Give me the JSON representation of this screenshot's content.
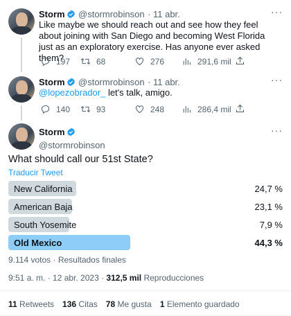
{
  "tweets": [
    {
      "name": "Storm",
      "handle": "@stormrobinson",
      "date": "· 11 abr.",
      "text": "Like maybe we should reach out and see how they feel about joining with San Diego and becoming West Florida just as an exploratory exercise. Has anyone ever asked them?",
      "replies": "197",
      "retweets": "68",
      "likes": "276",
      "views": "291,6 mil"
    },
    {
      "name": "Storm",
      "handle": "@stormrobinson",
      "date": "· 11 abr.",
      "mention": "@lopezobrador_",
      "text": " let's talk, amigo.",
      "replies": "140",
      "retweets": "93",
      "likes": "248",
      "views": "286,4 mil"
    }
  ],
  "main": {
    "name": "Storm",
    "handle": "@stormrobinson",
    "text": "What should call our 51st State?",
    "translate": "Traducir Tweet",
    "poll": {
      "options": [
        {
          "label": "New California",
          "pct": "24,7 %",
          "value": 24.7
        },
        {
          "label": "American Baja",
          "pct": "23,1 %",
          "value": 23.1
        },
        {
          "label": "South Yosemite",
          "pct": "7,9 %",
          "value": 7.9
        },
        {
          "label": "Old Mexico",
          "pct": "44,3 %",
          "value": 44.3,
          "winner": true
        }
      ],
      "summary": "9.114 votos · Resultados finales"
    },
    "timestamp": "9:51 a. m. · 12 abr. 2023 · ",
    "views_count": "312,5 mil",
    "views_label": " Reproducciones",
    "stats": {
      "retweets_count": "11",
      "retweets_label": " Retweets",
      "quotes_count": "136",
      "quotes_label": " Citas",
      "likes_count": "78",
      "likes_label": " Me gusta",
      "bookmarks_count": "1",
      "bookmarks_label": " Elemento guardado"
    }
  },
  "colors": {
    "accent": "#1d9bf0",
    "poll_bar": "#cfd9de",
    "poll_winner": "#8ecdf8"
  }
}
